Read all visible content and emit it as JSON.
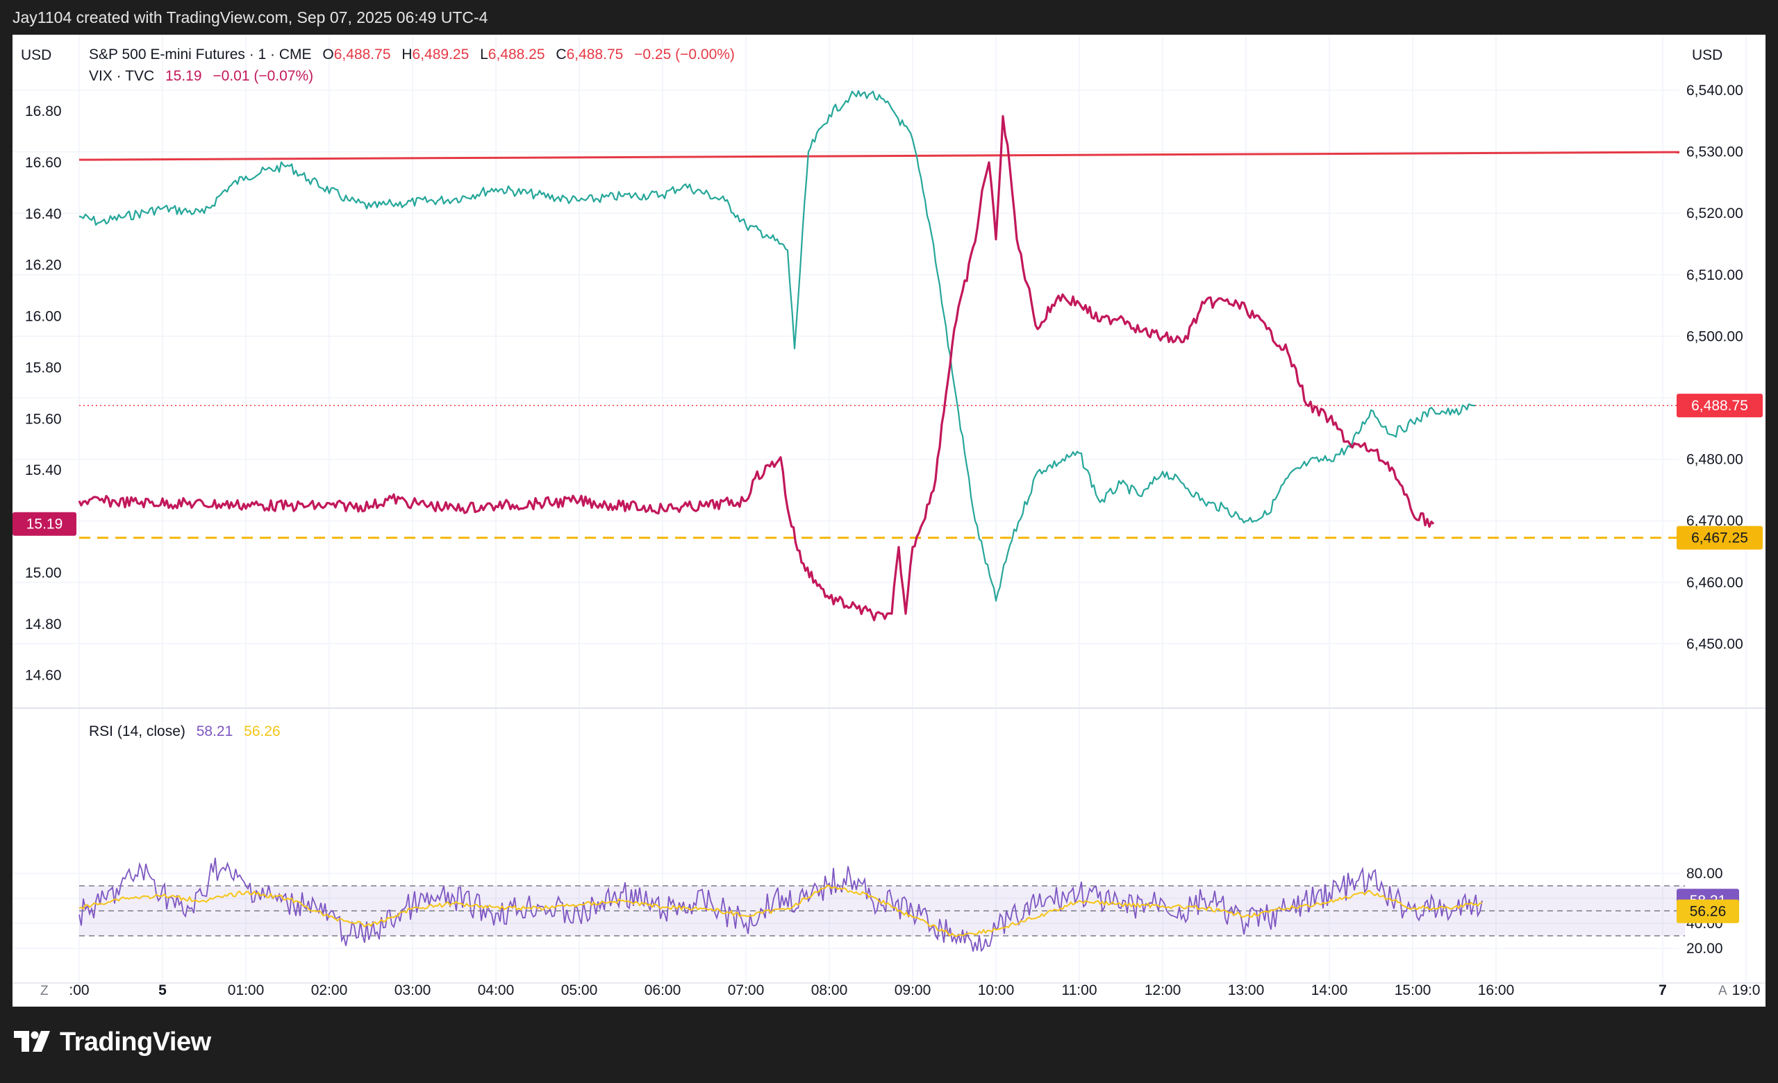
{
  "header": {
    "attribution": "Jay1104 created with TradingView.com, Sep 07, 2025 06:49 UTC-4"
  },
  "footer": {
    "brand": "TradingView"
  },
  "legend": {
    "main_symbol": "S&P 500 E-mini Futures · 1 · CME",
    "o_label": "O",
    "o_value": "6,488.75",
    "h_label": "H",
    "h_value": "6,489.25",
    "l_label": "L",
    "l_value": "6,488.25",
    "c_label": "C",
    "c_value": "6,488.75",
    "change": "−0.25 (−0.00%)",
    "vix_symbol": "VIX · TVC",
    "vix_value": "15.19",
    "vix_change": "−0.01 (−0.07%)",
    "rsi_title": "RSI (14, close)",
    "rsi_value": "58.21",
    "rsi_ma_value": "56.26"
  },
  "axes": {
    "left_currency": "USD",
    "right_currency": "USD",
    "left_ticks": [
      "16.80",
      "16.60",
      "16.40",
      "16.20",
      "16.00",
      "15.80",
      "15.60",
      "15.40",
      "15.00",
      "14.80",
      "14.60"
    ],
    "right_ticks": [
      "6,540.00",
      "6,530.00",
      "6,520.00",
      "6,510.00",
      "6,500.00",
      "6,480.00",
      "6,470.00",
      "6,460.00",
      "6,450.00"
    ],
    "rsi_ticks": [
      "80.00",
      "40.00",
      "20.00"
    ],
    "time_ticks": [
      ":00",
      "5",
      "01:00",
      "02:00",
      "03:00",
      "04:00",
      "05:00",
      "06:00",
      "07:00",
      "08:00",
      "09:00",
      "10:00",
      "11:00",
      "12:00",
      "13:00",
      "14:00",
      "15:00",
      "16:00",
      "7",
      "19:0"
    ],
    "bold_time_ticks": [
      "5",
      "7"
    ],
    "z_button": "Z",
    "a_button": "A",
    "price_badge": "6,488.75",
    "support_badge": "6,467.25",
    "vix_badge": "15.19",
    "rsi_badge": "58.21",
    "rsi_ma_badge": "56.26"
  },
  "colors": {
    "up": "#26a69a",
    "down": "#ef5350",
    "vix": "#c2185b",
    "resistance": "#e53945",
    "support": "#f5b70a",
    "rsi": "#7e57c2",
    "rsi_ma": "#f5c518",
    "price_badge": "#f23645"
  },
  "chart_data": [
    {
      "type": "line",
      "series": [
        {
          "name": "S&P 500 E-mini Futures · 1 · CME",
          "x": [
            "00:00",
            "00:15",
            "00:30",
            "01:00",
            "01:30",
            "01:45",
            "02:00",
            "02:30",
            "02:45",
            "03:15",
            "03:30",
            "03:45",
            "04:30",
            "05:00",
            "05:30",
            "06:00",
            "06:30",
            "07:00",
            "07:15",
            "07:45",
            "08:00",
            "08:15",
            "08:30",
            "08:35",
            "08:45",
            "09:00",
            "09:15",
            "09:30",
            "09:45",
            "10:00",
            "10:15",
            "10:30",
            "10:45",
            "11:00",
            "11:10",
            "11:30",
            "12:00",
            "12:15",
            "12:30",
            "12:45",
            "13:00",
            "13:15",
            "13:30",
            "13:45",
            "14:00",
            "14:15",
            "14:30",
            "14:45",
            "15:00",
            "15:15",
            "15:30",
            "15:45",
            "16:00",
            "16:15",
            "16:30",
            "16:45"
          ],
          "values": [
            6519.5,
            6518.5,
            6519.3,
            6520.8,
            6520.0,
            6523.8,
            6526.0,
            6527.8,
            6525.5,
            6522.0,
            6521.0,
            6521.5,
            6522.3,
            6524.0,
            6523.0,
            6522.0,
            6522.8,
            6523.0,
            6524.5,
            6522.0,
            6518.0,
            6516.5,
            6514.0,
            6498.0,
            6530.0,
            6536.0,
            6539.0,
            6539.5,
            6537.0,
            6532.0,
            6515.0,
            6492.0,
            6470.0,
            6457.0,
            6466.0,
            6478.0,
            6481.0,
            6473.0,
            6476.0,
            6474.0,
            6478.0,
            6476.0,
            6473.0,
            6472.0,
            6470.0,
            6471.0,
            6477.0,
            6479.5,
            6480.0,
            6482.0,
            6488.0,
            6484.0,
            6486.0,
            6488.0,
            6487.5,
            6488.75
          ]
        },
        {
          "name": "VIX · TVC",
          "x": [
            "00:00",
            "02:30",
            "03:30",
            "03:45",
            "04:00",
            "04:30",
            "05:00",
            "05:30",
            "06:00",
            "06:30",
            "07:00",
            "07:30",
            "08:00",
            "08:05",
            "08:25",
            "08:30",
            "08:40",
            "08:50",
            "09:00",
            "09:20",
            "09:40",
            "09:45",
            "09:50",
            "09:55",
            "10:00",
            "10:15",
            "10:30",
            "10:45",
            "10:50",
            "10:55",
            "11:00",
            "11:05",
            "11:10",
            "11:15",
            "11:30",
            "11:45",
            "12:00",
            "12:15",
            "12:30",
            "12:45",
            "13:00",
            "13:15",
            "13:30",
            "13:45",
            "14:00",
            "14:15",
            "14:30",
            "14:45",
            "15:00",
            "15:15",
            "15:30",
            "15:45",
            "16:00",
            "16:15"
          ],
          "values": [
            15.28,
            15.26,
            15.26,
            15.29,
            15.27,
            15.25,
            15.26,
            15.27,
            15.28,
            15.26,
            15.25,
            15.26,
            15.28,
            15.36,
            15.45,
            15.25,
            15.04,
            14.97,
            14.9,
            14.86,
            14.82,
            14.84,
            15.1,
            14.84,
            15.1,
            15.32,
            15.95,
            16.29,
            16.49,
            16.6,
            16.3,
            16.78,
            16.58,
            16.3,
            15.95,
            16.08,
            16.05,
            15.98,
            16.0,
            15.94,
            15.92,
            15.9,
            16.05,
            16.06,
            16.03,
            15.95,
            15.86,
            15.65,
            15.6,
            15.5,
            15.48,
            15.41,
            15.23,
            15.19
          ]
        }
      ],
      "title": "",
      "left_axis_series": "VIX · TVC",
      "right_axis_series": "S&P 500 E-mini Futures · 1 · CME",
      "ylim_left": [
        14.55,
        16.95
      ],
      "ylim_right": [
        6447,
        6547
      ],
      "resistance_line": {
        "start_left": 16.61,
        "end_left": 16.64
      },
      "support_line": 6467.25,
      "last_price": 6488.75,
      "grid": true
    },
    {
      "type": "line",
      "series": [
        {
          "name": "RSI (14, close)",
          "x": [
            "00:00",
            "00:15",
            "00:45",
            "01:15",
            "01:30",
            "01:35",
            "02:00",
            "02:30",
            "02:45",
            "03:15",
            "03:30",
            "04:00",
            "04:30",
            "05:00",
            "05:30",
            "06:00",
            "06:30",
            "07:00",
            "07:30",
            "08:00",
            "08:20",
            "08:45",
            "09:00",
            "09:15",
            "09:30",
            "10:00",
            "10:15",
            "10:30",
            "10:45",
            "11:00",
            "11:15",
            "11:30",
            "12:00",
            "12:30",
            "13:00",
            "13:15",
            "13:30",
            "14:00",
            "14:30",
            "15:00",
            "15:15",
            "15:30",
            "15:45",
            "16:00",
            "16:30",
            "16:50"
          ],
          "values": [
            47,
            55,
            83,
            48,
            62,
            88,
            70,
            55,
            58,
            30,
            32,
            55,
            60,
            48,
            55,
            45,
            65,
            50,
            58,
            40,
            60,
            58,
            72,
            78,
            60,
            50,
            38,
            30,
            25,
            35,
            45,
            55,
            65,
            52,
            58,
            47,
            60,
            40,
            50,
            65,
            70,
            75,
            58,
            52,
            50,
            58.21
          ]
        },
        {
          "name": "RSI-based MA",
          "x": [
            "00:00",
            "00:30",
            "01:00",
            "01:30",
            "02:00",
            "02:30",
            "03:00",
            "03:30",
            "04:00",
            "04:30",
            "05:00",
            "05:30",
            "06:00",
            "06:30",
            "07:00",
            "07:30",
            "08:00",
            "08:30",
            "09:00",
            "09:30",
            "10:00",
            "10:30",
            "11:00",
            "11:30",
            "12:00",
            "12:30",
            "13:00",
            "13:30",
            "14:00",
            "14:30",
            "15:00",
            "15:30",
            "16:00",
            "16:30",
            "16:50"
          ],
          "values": [
            52,
            60,
            62,
            58,
            65,
            60,
            45,
            38,
            52,
            56,
            53,
            52,
            55,
            58,
            53,
            52,
            46,
            52,
            70,
            62,
            45,
            30,
            35,
            45,
            58,
            55,
            54,
            52,
            46,
            52,
            57,
            65,
            52,
            53,
            56.26
          ]
        }
      ],
      "title": "RSI (14, close)",
      "ylim": [
        20,
        90
      ],
      "overbought": 70,
      "midline": 50,
      "oversold": 30
    }
  ]
}
